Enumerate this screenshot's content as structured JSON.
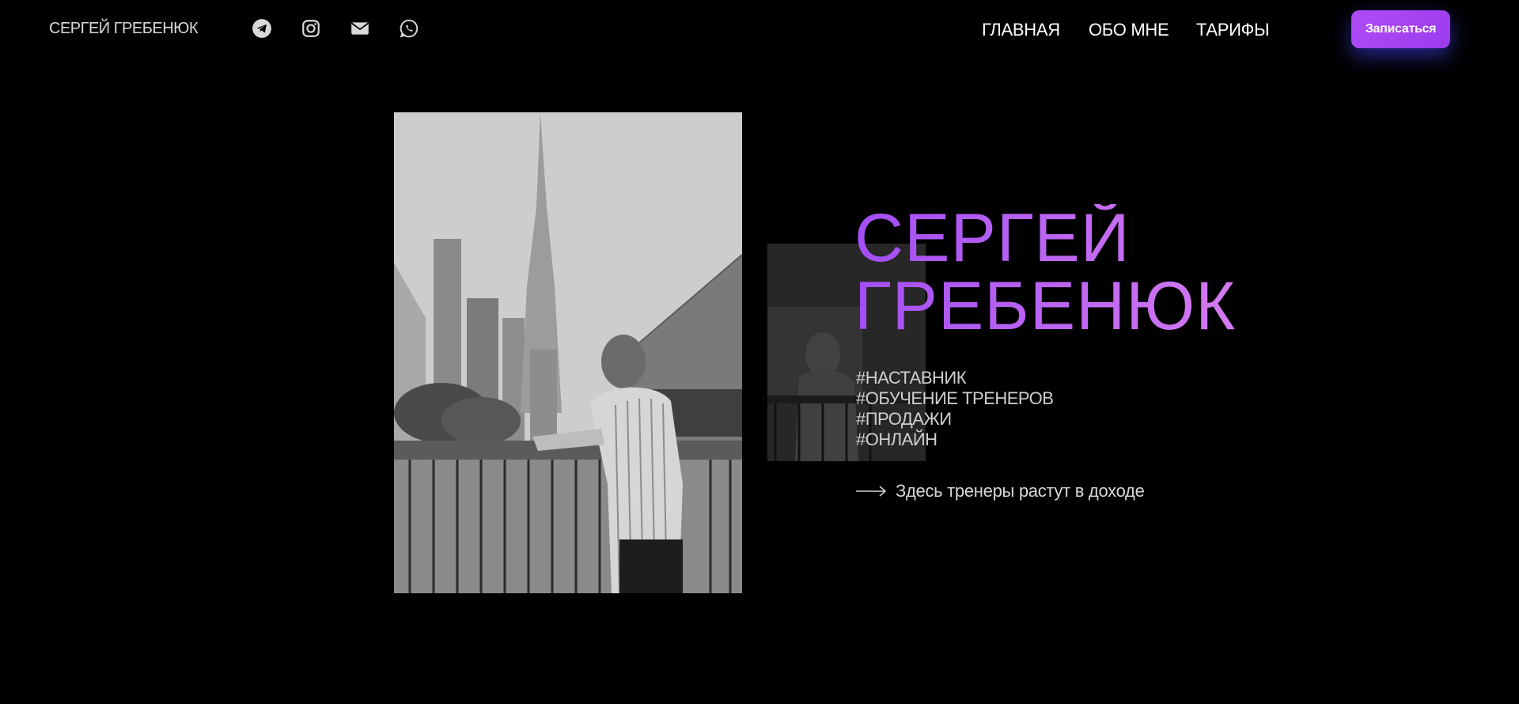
{
  "header": {
    "brand": "СЕРГЕЙ ГРЕБЕНЮК",
    "social_icons": [
      "telegram-icon",
      "instagram-icon",
      "mail-icon",
      "whatsapp-icon"
    ],
    "nav": [
      {
        "label": "ГЛАВНАЯ"
      },
      {
        "label": "ОБО МНЕ"
      },
      {
        "label": "ТАРИФЫ"
      }
    ],
    "cta_label": "Записаться"
  },
  "hero": {
    "name_line1": "СЕРГЕЙ",
    "name_line2": "ГРЕБЕНЮК",
    "tags": [
      "#НАСТАВНИК",
      "#ОБУЧЕНИЕ ТРЕНЕРОВ",
      "#ПРОДАЖИ",
      "#ОНЛАЙН"
    ],
    "tagline": "Здесь тренеры растут в доходе"
  },
  "colors": {
    "background": "#000000",
    "accent": "#b04cf5",
    "accent_light": "#d47af0",
    "cta_glow": "#4646ff"
  }
}
